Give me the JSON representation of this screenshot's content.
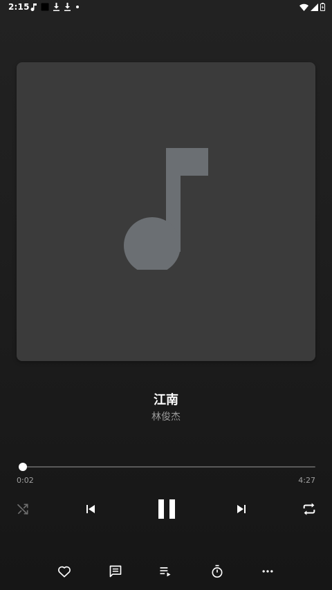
{
  "status_bar": {
    "time": "2:15"
  },
  "track": {
    "title": "江南",
    "artist": "林俊杰"
  },
  "progress": {
    "elapsed": "0:02",
    "total": "4:27",
    "fraction": 0.0075
  },
  "icons": {
    "status_left": [
      "music-note-icon",
      "app-square-icon",
      "download-icon",
      "download-icon",
      "dot-icon"
    ],
    "status_right": [
      "wifi-icon",
      "cellular-signal-icon",
      "battery-icon"
    ],
    "album_placeholder": "music-note-icon",
    "controls": [
      "shuffle-icon",
      "skip-previous-icon",
      "pause-icon",
      "skip-next-icon",
      "repeat-icon"
    ],
    "actions": [
      "heart-icon",
      "comment-icon",
      "queue-icon",
      "timer-icon",
      "more-icon"
    ]
  },
  "colors": {
    "background": "#1c1c1c",
    "album_art": "#3b3b3b",
    "note": "#6b6f73",
    "accent": "#ffffff",
    "secondary_text": "#9a9a9a"
  }
}
